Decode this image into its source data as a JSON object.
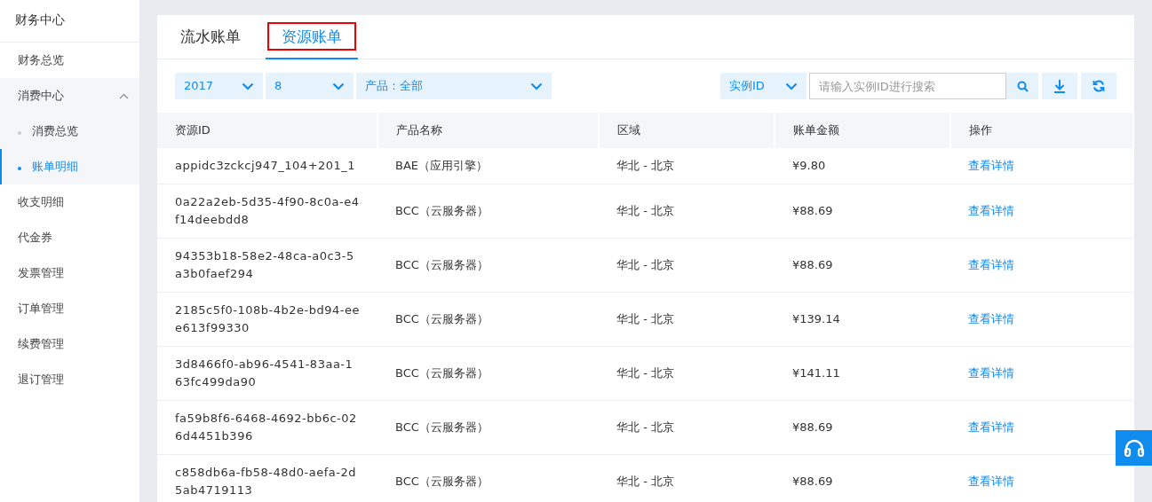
{
  "sidebar": {
    "title": "财务中心",
    "items": [
      {
        "label": "财务总览",
        "selected": false
      },
      {
        "label": "消费中心",
        "selected": false,
        "expanded": true,
        "children": [
          {
            "label": "消费总览",
            "selected": false
          },
          {
            "label": "账单明细",
            "selected": true
          }
        ]
      },
      {
        "label": "收支明细",
        "selected": false
      },
      {
        "label": "代金券",
        "selected": false
      },
      {
        "label": "发票管理",
        "selected": false
      },
      {
        "label": "订单管理",
        "selected": false
      },
      {
        "label": "续费管理",
        "selected": false
      },
      {
        "label": "退订管理",
        "selected": false
      }
    ]
  },
  "tabs": [
    {
      "label": "流水账单",
      "selected": false,
      "outlined": false
    },
    {
      "label": "资源账单",
      "selected": true,
      "outlined": true
    }
  ],
  "filters": [
    {
      "value": "2017"
    },
    {
      "value": "8"
    },
    {
      "value": "产品：全部"
    }
  ],
  "search": {
    "field": "实例ID",
    "placeholder": "请输入实例ID进行搜索"
  },
  "table": {
    "columns": [
      "资源ID",
      "产品名称",
      "区域",
      "账单金额",
      "操作"
    ],
    "rows": [
      [
        "appidc3zckcj947_104+201_1",
        "BAE（应用引擎）",
        "华北 - 北京",
        "¥9.80",
        "查看详情"
      ],
      [
        "0a22a2eb-5d35-4f90-8c0a-e4f14deebdd8",
        "BCC（云服务器）",
        "华北 - 北京",
        "¥88.69",
        "查看详情"
      ],
      [
        "94353b18-58e2-48ca-a0c3-5a3b0faef294",
        "BCC（云服务器）",
        "华北 - 北京",
        "¥88.69",
        "查看详情"
      ],
      [
        "2185c5f0-108b-4b2e-bd94-eee613f99330",
        "BCC（云服务器）",
        "华北 - 北京",
        "¥139.14",
        "查看详情"
      ],
      [
        "3d8466f0-ab96-4541-83aa-163fc499da90",
        "BCC（云服务器）",
        "华北 - 北京",
        "¥141.11",
        "查看详情"
      ],
      [
        "fa59b8f6-6468-4692-bb6c-026d4451b396",
        "BCC（云服务器）",
        "华北 - 北京",
        "¥88.69",
        "查看详情"
      ],
      [
        "c858db6a-fb58-48d0-aefa-2d5ab4719113",
        "BCC（云服务器）",
        "华北 - 北京",
        "¥88.69",
        "查看详情"
      ]
    ]
  }
}
